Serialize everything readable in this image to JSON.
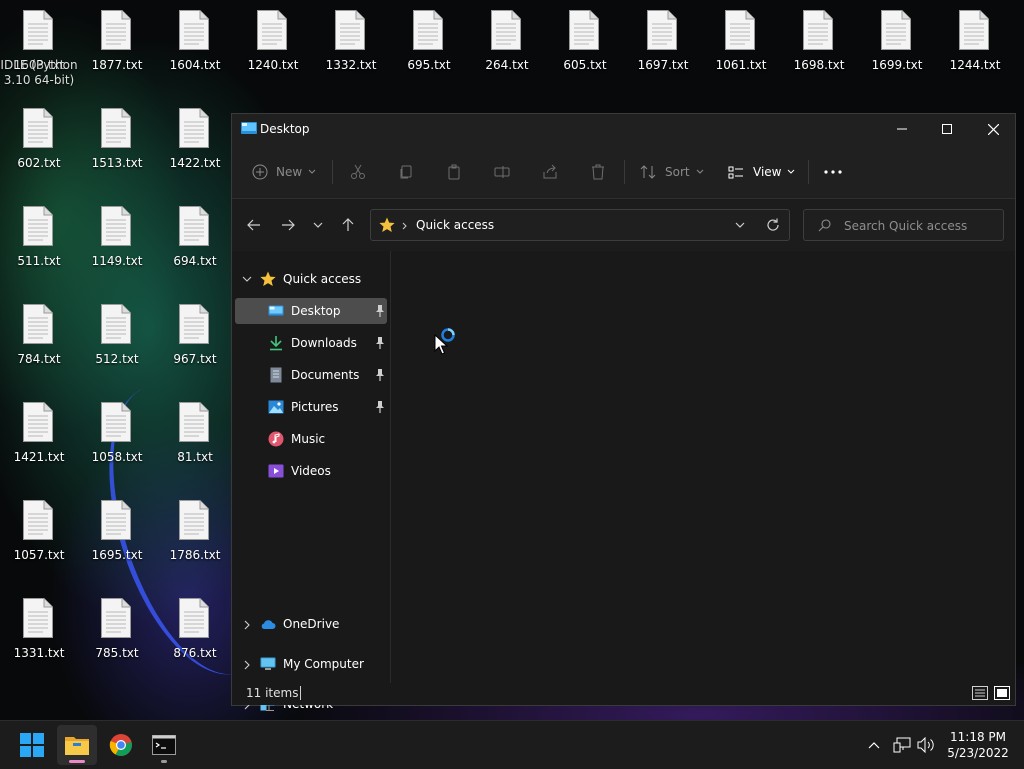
{
  "desktop": {
    "icons": [
      {
        "label": "1603.txt",
        "col": 0,
        "row": 0,
        "overlay_label": "IDLE (Python",
        "overlay_label2": "3.10 64-bit)"
      },
      {
        "label": "1877.txt",
        "col": 1,
        "row": 0
      },
      {
        "label": "1604.txt",
        "col": 2,
        "row": 0
      },
      {
        "label": "1240.txt",
        "col": 3,
        "row": 0
      },
      {
        "label": "1332.txt",
        "col": 4,
        "row": 0
      },
      {
        "label": "695.txt",
        "col": 5,
        "row": 0
      },
      {
        "label": "264.txt",
        "col": 6,
        "row": 0
      },
      {
        "label": "605.txt",
        "col": 7,
        "row": 0
      },
      {
        "label": "1697.txt",
        "col": 8,
        "row": 0
      },
      {
        "label": "1061.txt",
        "col": 9,
        "row": 0
      },
      {
        "label": "1698.txt",
        "col": 10,
        "row": 0
      },
      {
        "label": "1699.txt",
        "col": 11,
        "row": 0
      },
      {
        "label": "1244.txt",
        "col": 12,
        "row": 0
      },
      {
        "label": "602.txt",
        "col": 0,
        "row": 1
      },
      {
        "label": "1513.txt",
        "col": 1,
        "row": 1
      },
      {
        "label": "1422.txt",
        "col": 2,
        "row": 1
      },
      {
        "label": "511.txt",
        "col": 0,
        "row": 2
      },
      {
        "label": "1149.txt",
        "col": 1,
        "row": 2
      },
      {
        "label": "694.txt",
        "col": 2,
        "row": 2
      },
      {
        "label": "784.txt",
        "col": 0,
        "row": 3
      },
      {
        "label": "512.txt",
        "col": 1,
        "row": 3
      },
      {
        "label": "967.txt",
        "col": 2,
        "row": 3
      },
      {
        "label": "1421.txt",
        "col": 0,
        "row": 4
      },
      {
        "label": "1058.txt",
        "col": 1,
        "row": 4
      },
      {
        "label": "81.txt",
        "col": 2,
        "row": 4
      },
      {
        "label": "1057.txt",
        "col": 0,
        "row": 5
      },
      {
        "label": "1695.txt",
        "col": 1,
        "row": 5
      },
      {
        "label": "1786.txt",
        "col": 2,
        "row": 5
      },
      {
        "label": "1331.txt",
        "col": 0,
        "row": 6
      },
      {
        "label": "785.txt",
        "col": 1,
        "row": 6
      },
      {
        "label": "876.txt",
        "col": 2,
        "row": 6
      }
    ]
  },
  "explorer": {
    "title": "Desktop",
    "commands": {
      "new": "New",
      "sort": "Sort",
      "view": "View"
    },
    "address": {
      "location": "Quick access"
    },
    "search": {
      "placeholder": "Search Quick access"
    },
    "nav": {
      "quick_access": "Quick access",
      "pinned": [
        {
          "label": "Desktop",
          "icon": "desktop-icon",
          "pinned": true,
          "selected": true
        },
        {
          "label": "Downloads",
          "icon": "downloads-icon",
          "pinned": true
        },
        {
          "label": "Documents",
          "icon": "documents-icon",
          "pinned": true
        },
        {
          "label": "Pictures",
          "icon": "pictures-icon",
          "pinned": true
        },
        {
          "label": "Music",
          "icon": "music-icon",
          "pinned": false
        },
        {
          "label": "Videos",
          "icon": "videos-icon",
          "pinned": false
        }
      ],
      "onedrive": "OneDrive",
      "my_computer": "My Computer",
      "network": "Network"
    },
    "status": {
      "item_count": "11 items"
    }
  },
  "taskbar": {
    "clock_time": "11:18 PM",
    "clock_date": "5/23/2022"
  },
  "colors": {
    "accent": "#60cdff",
    "folder_yellow": "#f5c13d",
    "selected_bg": "#4d4d4d"
  }
}
